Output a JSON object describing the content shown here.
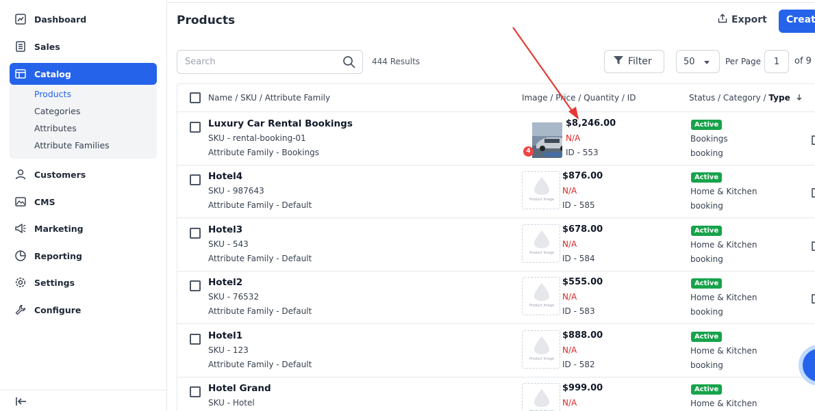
{
  "sidebar": {
    "items": [
      {
        "label": "Dashboard",
        "icon": "dashboard-icon"
      },
      {
        "label": "Sales",
        "icon": "sales-icon"
      },
      {
        "label": "Catalog",
        "icon": "catalog-icon"
      },
      {
        "label": "Customers",
        "icon": "customers-icon"
      },
      {
        "label": "CMS",
        "icon": "cms-icon"
      },
      {
        "label": "Marketing",
        "icon": "marketing-icon"
      },
      {
        "label": "Reporting",
        "icon": "reporting-icon"
      },
      {
        "label": "Settings",
        "icon": "settings-icon"
      },
      {
        "label": "Configure",
        "icon": "configure-icon"
      }
    ],
    "catalog_sub": [
      "Products",
      "Categories",
      "Attributes",
      "Attribute Families"
    ]
  },
  "header": {
    "title": "Products",
    "export_label": "Export",
    "create_label": "Create"
  },
  "toolbar": {
    "search_placeholder": "Search",
    "results": "444 Results",
    "filter_label": "Filter",
    "per_page_value": "50",
    "per_page_label": "Per Page",
    "page_value": "1",
    "page_of": "of 9"
  },
  "table": {
    "headers": {
      "col1": "Name / SKU / Attribute Family",
      "col2": "Image / Price / Quantity / ID",
      "col3_prefix": "Status / Category / ",
      "col3_bold": "Type"
    },
    "placeholder_text": "Product Image",
    "rows": [
      {
        "name": "Luxury Car Rental Bookings",
        "sku": "SKU - rental-booking-01",
        "family": "Attribute Family - Bookings",
        "price": "$8,246.00",
        "qty": "N/A",
        "id": "ID - 553",
        "status": "Active",
        "category": "Bookings",
        "type": "booking",
        "image_count": "4"
      },
      {
        "name": "Hotel4",
        "sku": "SKU - 987643",
        "family": "Attribute Family - Default",
        "price": "$876.00",
        "qty": "N/A",
        "id": "ID - 585",
        "status": "Active",
        "category": "Home & Kitchen",
        "type": "booking"
      },
      {
        "name": "Hotel3",
        "sku": "SKU - 543",
        "family": "Attribute Family - Default",
        "price": "$678.00",
        "qty": "N/A",
        "id": "ID - 584",
        "status": "Active",
        "category": "Home & Kitchen",
        "type": "booking"
      },
      {
        "name": "Hotel2",
        "sku": "SKU - 76532",
        "family": "Attribute Family - Default",
        "price": "$555.00",
        "qty": "N/A",
        "id": "ID - 583",
        "status": "Active",
        "category": "Home & Kitchen",
        "type": "booking"
      },
      {
        "name": "Hotel1",
        "sku": "SKU - 123",
        "family": "Attribute Family - Default",
        "price": "$888.00",
        "qty": "N/A",
        "id": "ID - 582",
        "status": "Active",
        "category": "Home & Kitchen",
        "type": "booking"
      },
      {
        "name": "Hotel Grand",
        "sku": "SKU - Hotel",
        "family": "",
        "price": "$999.00",
        "qty": "N/A",
        "id": "",
        "status": "Active",
        "category": "Home & Kitchen",
        "type": ""
      }
    ]
  },
  "colors": {
    "accent": "#2563eb",
    "active": "#16a34a",
    "danger": "#dc2626",
    "arrow": "#e53935"
  }
}
